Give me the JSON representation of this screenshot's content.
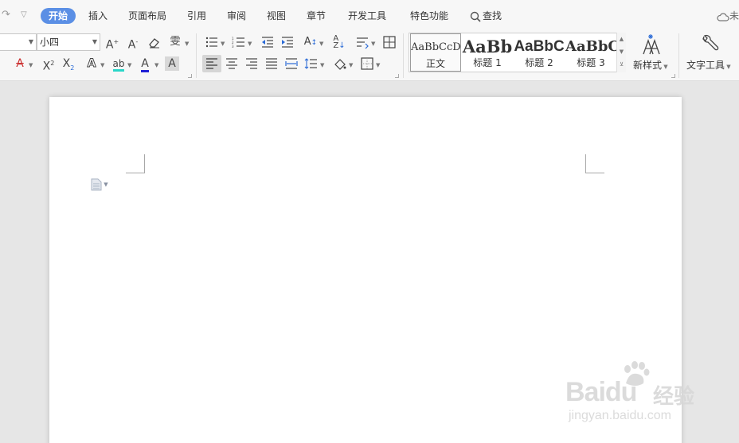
{
  "tabbar": {
    "tabs": [
      "开始",
      "插入",
      "页面布局",
      "引用",
      "审阅",
      "视图",
      "章节",
      "开发工具",
      "特色功能"
    ],
    "active_tab": "开始",
    "search_label": "查找",
    "cloud_label": "未",
    "accent": "#5b8fe5"
  },
  "ribbon": {
    "font_name": "",
    "font_size": "小四",
    "styles": [
      {
        "sample": "AaBbCcDd",
        "name": "正文"
      },
      {
        "sample": "AaBb",
        "name": "标题 1"
      },
      {
        "sample": "AaBbC",
        "name": "标题 2"
      },
      {
        "sample": "AaBbC",
        "name": "标题 3"
      }
    ],
    "new_style_label": "新样式",
    "text_tools_label": "文字工具"
  },
  "watermark": {
    "brand": "Baidu",
    "brand_cn": "经验",
    "url": "jingyan.baidu.com"
  }
}
